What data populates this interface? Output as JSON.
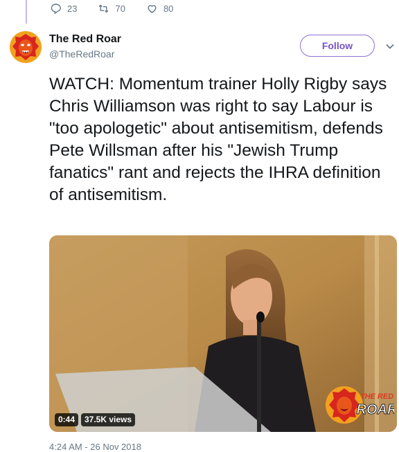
{
  "previous_tweet": {
    "reply_count": "23",
    "retweet_count": "70",
    "like_count": "80"
  },
  "tweet": {
    "author_name": "The Red Roar",
    "author_handle": "@TheRedRoar",
    "follow_label": "Follow",
    "text": "WATCH: Momentum trainer Holly Rigby says Chris Williamson was right to say Labour is \"too apologetic\" about antisemitism, defends Pete Willsman after his \"Jewish Trump fanatics\" rant and rejects the IHRA definition of antisemitism.",
    "timestamp": "4:24 AM - 26 Nov 2018"
  },
  "video": {
    "duration": "0:44",
    "views": "37.5K views",
    "watermark_top": "THE RED",
    "watermark_bottom": "ROAR"
  },
  "icons": {
    "reply": "reply-icon",
    "retweet": "retweet-icon",
    "like": "heart-icon",
    "caret": "chevron-down-icon"
  },
  "colors": {
    "follow_accent": "#7354c5",
    "thread_line": "#c8b8e8",
    "muted_text": "#657786"
  }
}
